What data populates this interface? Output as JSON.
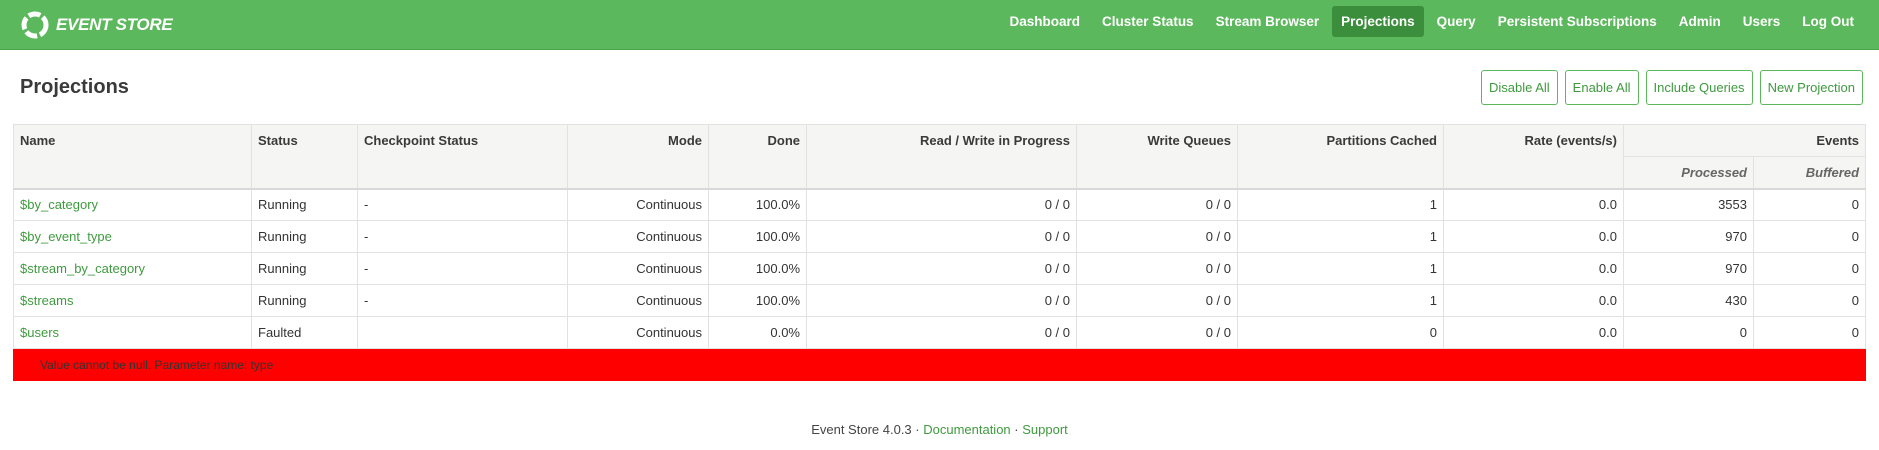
{
  "brand": {
    "name": "EVENT STORE",
    "logo_icon": "event-store-ring-logo"
  },
  "nav": [
    {
      "label": "Dashboard",
      "active": false
    },
    {
      "label": "Cluster Status",
      "active": false
    },
    {
      "label": "Stream Browser",
      "active": false
    },
    {
      "label": "Projections",
      "active": true
    },
    {
      "label": "Query",
      "active": false
    },
    {
      "label": "Persistent Subscriptions",
      "active": false
    },
    {
      "label": "Admin",
      "active": false
    },
    {
      "label": "Users",
      "active": false
    },
    {
      "label": "Log Out",
      "active": false
    }
  ],
  "page": {
    "title": "Projections"
  },
  "actions": {
    "disable_all": "Disable All",
    "enable_all": "Enable All",
    "include_queries": "Include Queries",
    "new_projection": "New Projection"
  },
  "table": {
    "headers": {
      "name": "Name",
      "status": "Status",
      "checkpoint_status": "Checkpoint Status",
      "mode": "Mode",
      "done": "Done",
      "read_write": "Read / Write in Progress",
      "write_queues": "Write Queues",
      "partitions_cached": "Partitions Cached",
      "rate": "Rate (events/s)",
      "events": "Events",
      "processed": "Processed",
      "buffered": "Buffered"
    },
    "rows": [
      {
        "name": "$by_category",
        "status": "Running",
        "checkpoint": "-",
        "mode": "Continuous",
        "done": "100.0%",
        "rw": "0 / 0",
        "wq": "0 / 0",
        "partitions": "1",
        "rate": "0.0",
        "processed": "3553",
        "buffered": "0"
      },
      {
        "name": "$by_event_type",
        "status": "Running",
        "checkpoint": "-",
        "mode": "Continuous",
        "done": "100.0%",
        "rw": "0 / 0",
        "wq": "0 / 0",
        "partitions": "1",
        "rate": "0.0",
        "processed": "970",
        "buffered": "0"
      },
      {
        "name": "$stream_by_category",
        "status": "Running",
        "checkpoint": "-",
        "mode": "Continuous",
        "done": "100.0%",
        "rw": "0 / 0",
        "wq": "0 / 0",
        "partitions": "1",
        "rate": "0.0",
        "processed": "970",
        "buffered": "0"
      },
      {
        "name": "$streams",
        "status": "Running",
        "checkpoint": "-",
        "mode": "Continuous",
        "done": "100.0%",
        "rw": "0 / 0",
        "wq": "0 / 0",
        "partitions": "1",
        "rate": "0.0",
        "processed": "430",
        "buffered": "0"
      },
      {
        "name": "$users",
        "status": "Faulted",
        "checkpoint": "",
        "mode": "Continuous",
        "done": "0.0%",
        "rw": "0 / 0",
        "wq": "0 / 0",
        "partitions": "0",
        "rate": "0.0",
        "processed": "0",
        "buffered": "0"
      }
    ],
    "error_message": "Value cannot be null. Parameter name: type"
  },
  "footer": {
    "version": "Event Store 4.0.3",
    "separator": " · ",
    "documentation": "Documentation",
    "support": "Support"
  },
  "colors": {
    "nav_bg": "#5cb85c",
    "nav_active": "#3b8e3b",
    "link": "#3f9a3f",
    "error_bg": "#ff0000"
  }
}
